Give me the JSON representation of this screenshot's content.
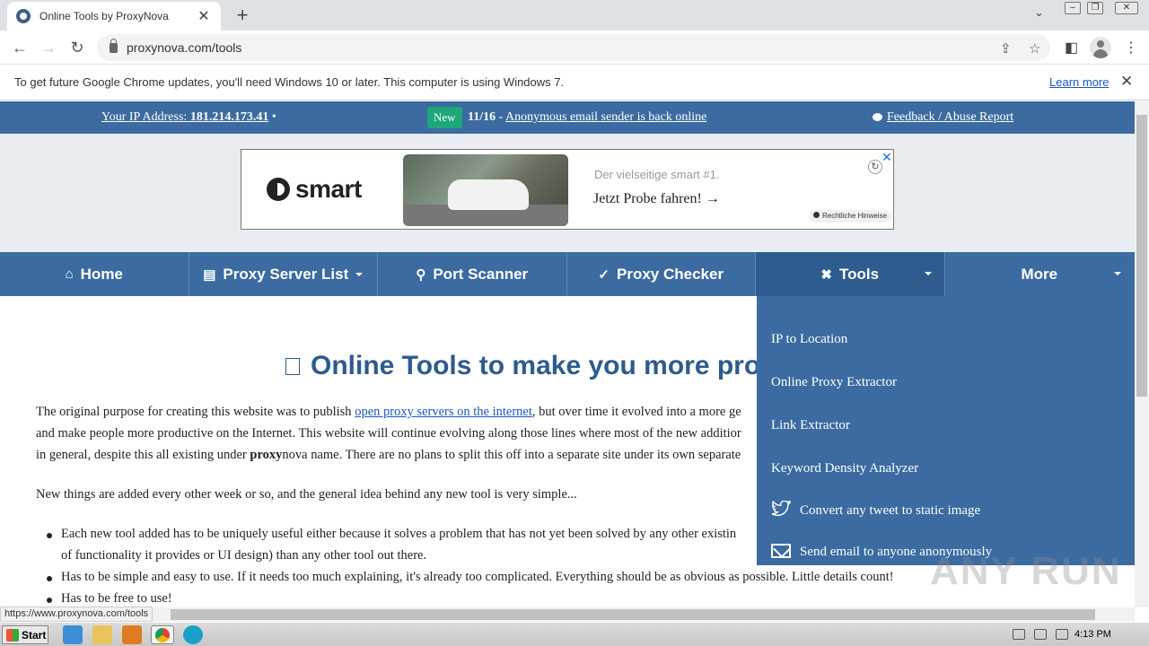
{
  "browser": {
    "tab_title": "Online Tools by ProxyNova",
    "tab_close": "✕",
    "new_tab": "+",
    "url": "proxynova.com/tools",
    "info_bar_text": "To get future Google Chrome updates, you'll need Windows 10 or later. This computer is using Windows 7.",
    "info_bar_link": "Learn more",
    "info_bar_close": "✕",
    "status_url": "https://www.proxynova.com/tools"
  },
  "topbar": {
    "ip_label": "Your IP Address: ",
    "ip_value": "181.214.173.41",
    "ip_suffix": " •",
    "new_badge": "New",
    "news_date": "11/16",
    "news_sep": " - ",
    "news_link": "Anonymous email sender is back online",
    "feedback": "Feedback / Abuse Report"
  },
  "ad": {
    "brand": "smart",
    "subtitle": "Der vielseitige smart #1.",
    "cta": "Jetzt Probe fahren! →",
    "hint": "Rechtliche Hinweise"
  },
  "nav": [
    {
      "label": "Home",
      "icon": "home-icon",
      "glyph": "⌂"
    },
    {
      "label": "Proxy Server List",
      "icon": "server-icon",
      "glyph": "▤"
    },
    {
      "label": "Port Scanner",
      "icon": "search-icon",
      "glyph": "⚲"
    },
    {
      "label": "Proxy Checker",
      "icon": "check-icon",
      "glyph": "✓"
    },
    {
      "label": "Tools",
      "icon": "tools-icon",
      "glyph": "✖"
    },
    {
      "label": "More",
      "icon": "",
      "glyph": ""
    }
  ],
  "main": {
    "heading": "Online Tools to make you more pro",
    "p1_line1_a": "The original purpose for creating this website was to publish ",
    "p1_link": "open proxy servers on the internet",
    "p1_line1_b": ", but over time it evolved into a more ge",
    "p1_line2": "and make people more productive on the Internet. This website will continue evolving along those lines where most of the new additior",
    "p1_line3_a": "in general, despite this all existing under ",
    "p1_line3_bold": "proxy",
    "p1_line3_b": "nova name. There are no plans to split this off into a separate site under its own separate",
    "p2": "New things are added every other week or so, and the general idea behind any new tool is very simple...",
    "bullets": [
      "Each new tool added has to be uniquely useful either because it solves a problem that has not yet been solved by any other existin",
      "of functionality it provides or UI design) than any other tool out there.",
      "Has to be simple and easy to use. If it needs too much explaining, it's already too complicated. Everything should be as obvious as possible. Little details count!",
      "Has to be free to use!"
    ]
  },
  "dropdown": [
    {
      "label": "IP to Location"
    },
    {
      "label": "Online Proxy Extractor"
    },
    {
      "label": "Link Extractor"
    },
    {
      "label": "Keyword Density Analyzer"
    },
    {
      "label": "Convert any tweet to static image"
    },
    {
      "label": "Send email to anyone anonymously"
    }
  ],
  "watermark": "ANY RUN",
  "taskbar": {
    "start": "Start",
    "clock": "4:13 PM"
  },
  "colors": {
    "brand_blue": "#3b6ba0",
    "new_badge": "#1fa67a",
    "heading": "#2d5b8e"
  }
}
